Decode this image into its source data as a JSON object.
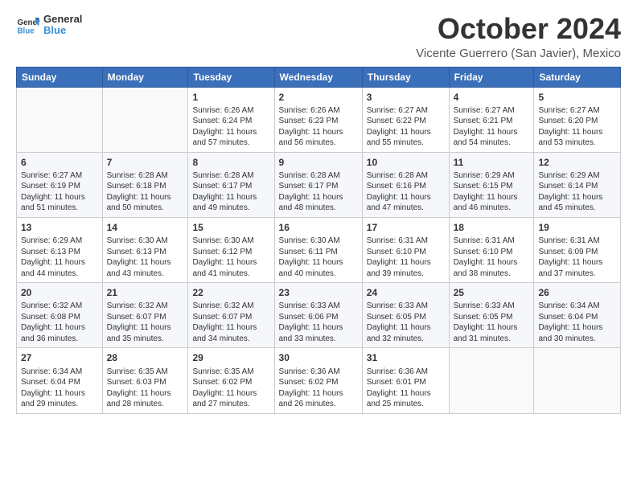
{
  "header": {
    "logo_line1": "General",
    "logo_line2": "Blue",
    "month": "October 2024",
    "location": "Vicente Guerrero (San Javier), Mexico"
  },
  "weekdays": [
    "Sunday",
    "Monday",
    "Tuesday",
    "Wednesday",
    "Thursday",
    "Friday",
    "Saturday"
  ],
  "weeks": [
    [
      {
        "day": "",
        "sunrise": "",
        "sunset": "",
        "daylight": ""
      },
      {
        "day": "",
        "sunrise": "",
        "sunset": "",
        "daylight": ""
      },
      {
        "day": "1",
        "sunrise": "Sunrise: 6:26 AM",
        "sunset": "Sunset: 6:24 PM",
        "daylight": "Daylight: 11 hours and 57 minutes."
      },
      {
        "day": "2",
        "sunrise": "Sunrise: 6:26 AM",
        "sunset": "Sunset: 6:23 PM",
        "daylight": "Daylight: 11 hours and 56 minutes."
      },
      {
        "day": "3",
        "sunrise": "Sunrise: 6:27 AM",
        "sunset": "Sunset: 6:22 PM",
        "daylight": "Daylight: 11 hours and 55 minutes."
      },
      {
        "day": "4",
        "sunrise": "Sunrise: 6:27 AM",
        "sunset": "Sunset: 6:21 PM",
        "daylight": "Daylight: 11 hours and 54 minutes."
      },
      {
        "day": "5",
        "sunrise": "Sunrise: 6:27 AM",
        "sunset": "Sunset: 6:20 PM",
        "daylight": "Daylight: 11 hours and 53 minutes."
      }
    ],
    [
      {
        "day": "6",
        "sunrise": "Sunrise: 6:27 AM",
        "sunset": "Sunset: 6:19 PM",
        "daylight": "Daylight: 11 hours and 51 minutes."
      },
      {
        "day": "7",
        "sunrise": "Sunrise: 6:28 AM",
        "sunset": "Sunset: 6:18 PM",
        "daylight": "Daylight: 11 hours and 50 minutes."
      },
      {
        "day": "8",
        "sunrise": "Sunrise: 6:28 AM",
        "sunset": "Sunset: 6:17 PM",
        "daylight": "Daylight: 11 hours and 49 minutes."
      },
      {
        "day": "9",
        "sunrise": "Sunrise: 6:28 AM",
        "sunset": "Sunset: 6:17 PM",
        "daylight": "Daylight: 11 hours and 48 minutes."
      },
      {
        "day": "10",
        "sunrise": "Sunrise: 6:28 AM",
        "sunset": "Sunset: 6:16 PM",
        "daylight": "Daylight: 11 hours and 47 minutes."
      },
      {
        "day": "11",
        "sunrise": "Sunrise: 6:29 AM",
        "sunset": "Sunset: 6:15 PM",
        "daylight": "Daylight: 11 hours and 46 minutes."
      },
      {
        "day": "12",
        "sunrise": "Sunrise: 6:29 AM",
        "sunset": "Sunset: 6:14 PM",
        "daylight": "Daylight: 11 hours and 45 minutes."
      }
    ],
    [
      {
        "day": "13",
        "sunrise": "Sunrise: 6:29 AM",
        "sunset": "Sunset: 6:13 PM",
        "daylight": "Daylight: 11 hours and 44 minutes."
      },
      {
        "day": "14",
        "sunrise": "Sunrise: 6:30 AM",
        "sunset": "Sunset: 6:13 PM",
        "daylight": "Daylight: 11 hours and 43 minutes."
      },
      {
        "day": "15",
        "sunrise": "Sunrise: 6:30 AM",
        "sunset": "Sunset: 6:12 PM",
        "daylight": "Daylight: 11 hours and 41 minutes."
      },
      {
        "day": "16",
        "sunrise": "Sunrise: 6:30 AM",
        "sunset": "Sunset: 6:11 PM",
        "daylight": "Daylight: 11 hours and 40 minutes."
      },
      {
        "day": "17",
        "sunrise": "Sunrise: 6:31 AM",
        "sunset": "Sunset: 6:10 PM",
        "daylight": "Daylight: 11 hours and 39 minutes."
      },
      {
        "day": "18",
        "sunrise": "Sunrise: 6:31 AM",
        "sunset": "Sunset: 6:10 PM",
        "daylight": "Daylight: 11 hours and 38 minutes."
      },
      {
        "day": "19",
        "sunrise": "Sunrise: 6:31 AM",
        "sunset": "Sunset: 6:09 PM",
        "daylight": "Daylight: 11 hours and 37 minutes."
      }
    ],
    [
      {
        "day": "20",
        "sunrise": "Sunrise: 6:32 AM",
        "sunset": "Sunset: 6:08 PM",
        "daylight": "Daylight: 11 hours and 36 minutes."
      },
      {
        "day": "21",
        "sunrise": "Sunrise: 6:32 AM",
        "sunset": "Sunset: 6:07 PM",
        "daylight": "Daylight: 11 hours and 35 minutes."
      },
      {
        "day": "22",
        "sunrise": "Sunrise: 6:32 AM",
        "sunset": "Sunset: 6:07 PM",
        "daylight": "Daylight: 11 hours and 34 minutes."
      },
      {
        "day": "23",
        "sunrise": "Sunrise: 6:33 AM",
        "sunset": "Sunset: 6:06 PM",
        "daylight": "Daylight: 11 hours and 33 minutes."
      },
      {
        "day": "24",
        "sunrise": "Sunrise: 6:33 AM",
        "sunset": "Sunset: 6:05 PM",
        "daylight": "Daylight: 11 hours and 32 minutes."
      },
      {
        "day": "25",
        "sunrise": "Sunrise: 6:33 AM",
        "sunset": "Sunset: 6:05 PM",
        "daylight": "Daylight: 11 hours and 31 minutes."
      },
      {
        "day": "26",
        "sunrise": "Sunrise: 6:34 AM",
        "sunset": "Sunset: 6:04 PM",
        "daylight": "Daylight: 11 hours and 30 minutes."
      }
    ],
    [
      {
        "day": "27",
        "sunrise": "Sunrise: 6:34 AM",
        "sunset": "Sunset: 6:04 PM",
        "daylight": "Daylight: 11 hours and 29 minutes."
      },
      {
        "day": "28",
        "sunrise": "Sunrise: 6:35 AM",
        "sunset": "Sunset: 6:03 PM",
        "daylight": "Daylight: 11 hours and 28 minutes."
      },
      {
        "day": "29",
        "sunrise": "Sunrise: 6:35 AM",
        "sunset": "Sunset: 6:02 PM",
        "daylight": "Daylight: 11 hours and 27 minutes."
      },
      {
        "day": "30",
        "sunrise": "Sunrise: 6:36 AM",
        "sunset": "Sunset: 6:02 PM",
        "daylight": "Daylight: 11 hours and 26 minutes."
      },
      {
        "day": "31",
        "sunrise": "Sunrise: 6:36 AM",
        "sunset": "Sunset: 6:01 PM",
        "daylight": "Daylight: 11 hours and 25 minutes."
      },
      {
        "day": "",
        "sunrise": "",
        "sunset": "",
        "daylight": ""
      },
      {
        "day": "",
        "sunrise": "",
        "sunset": "",
        "daylight": ""
      }
    ]
  ]
}
